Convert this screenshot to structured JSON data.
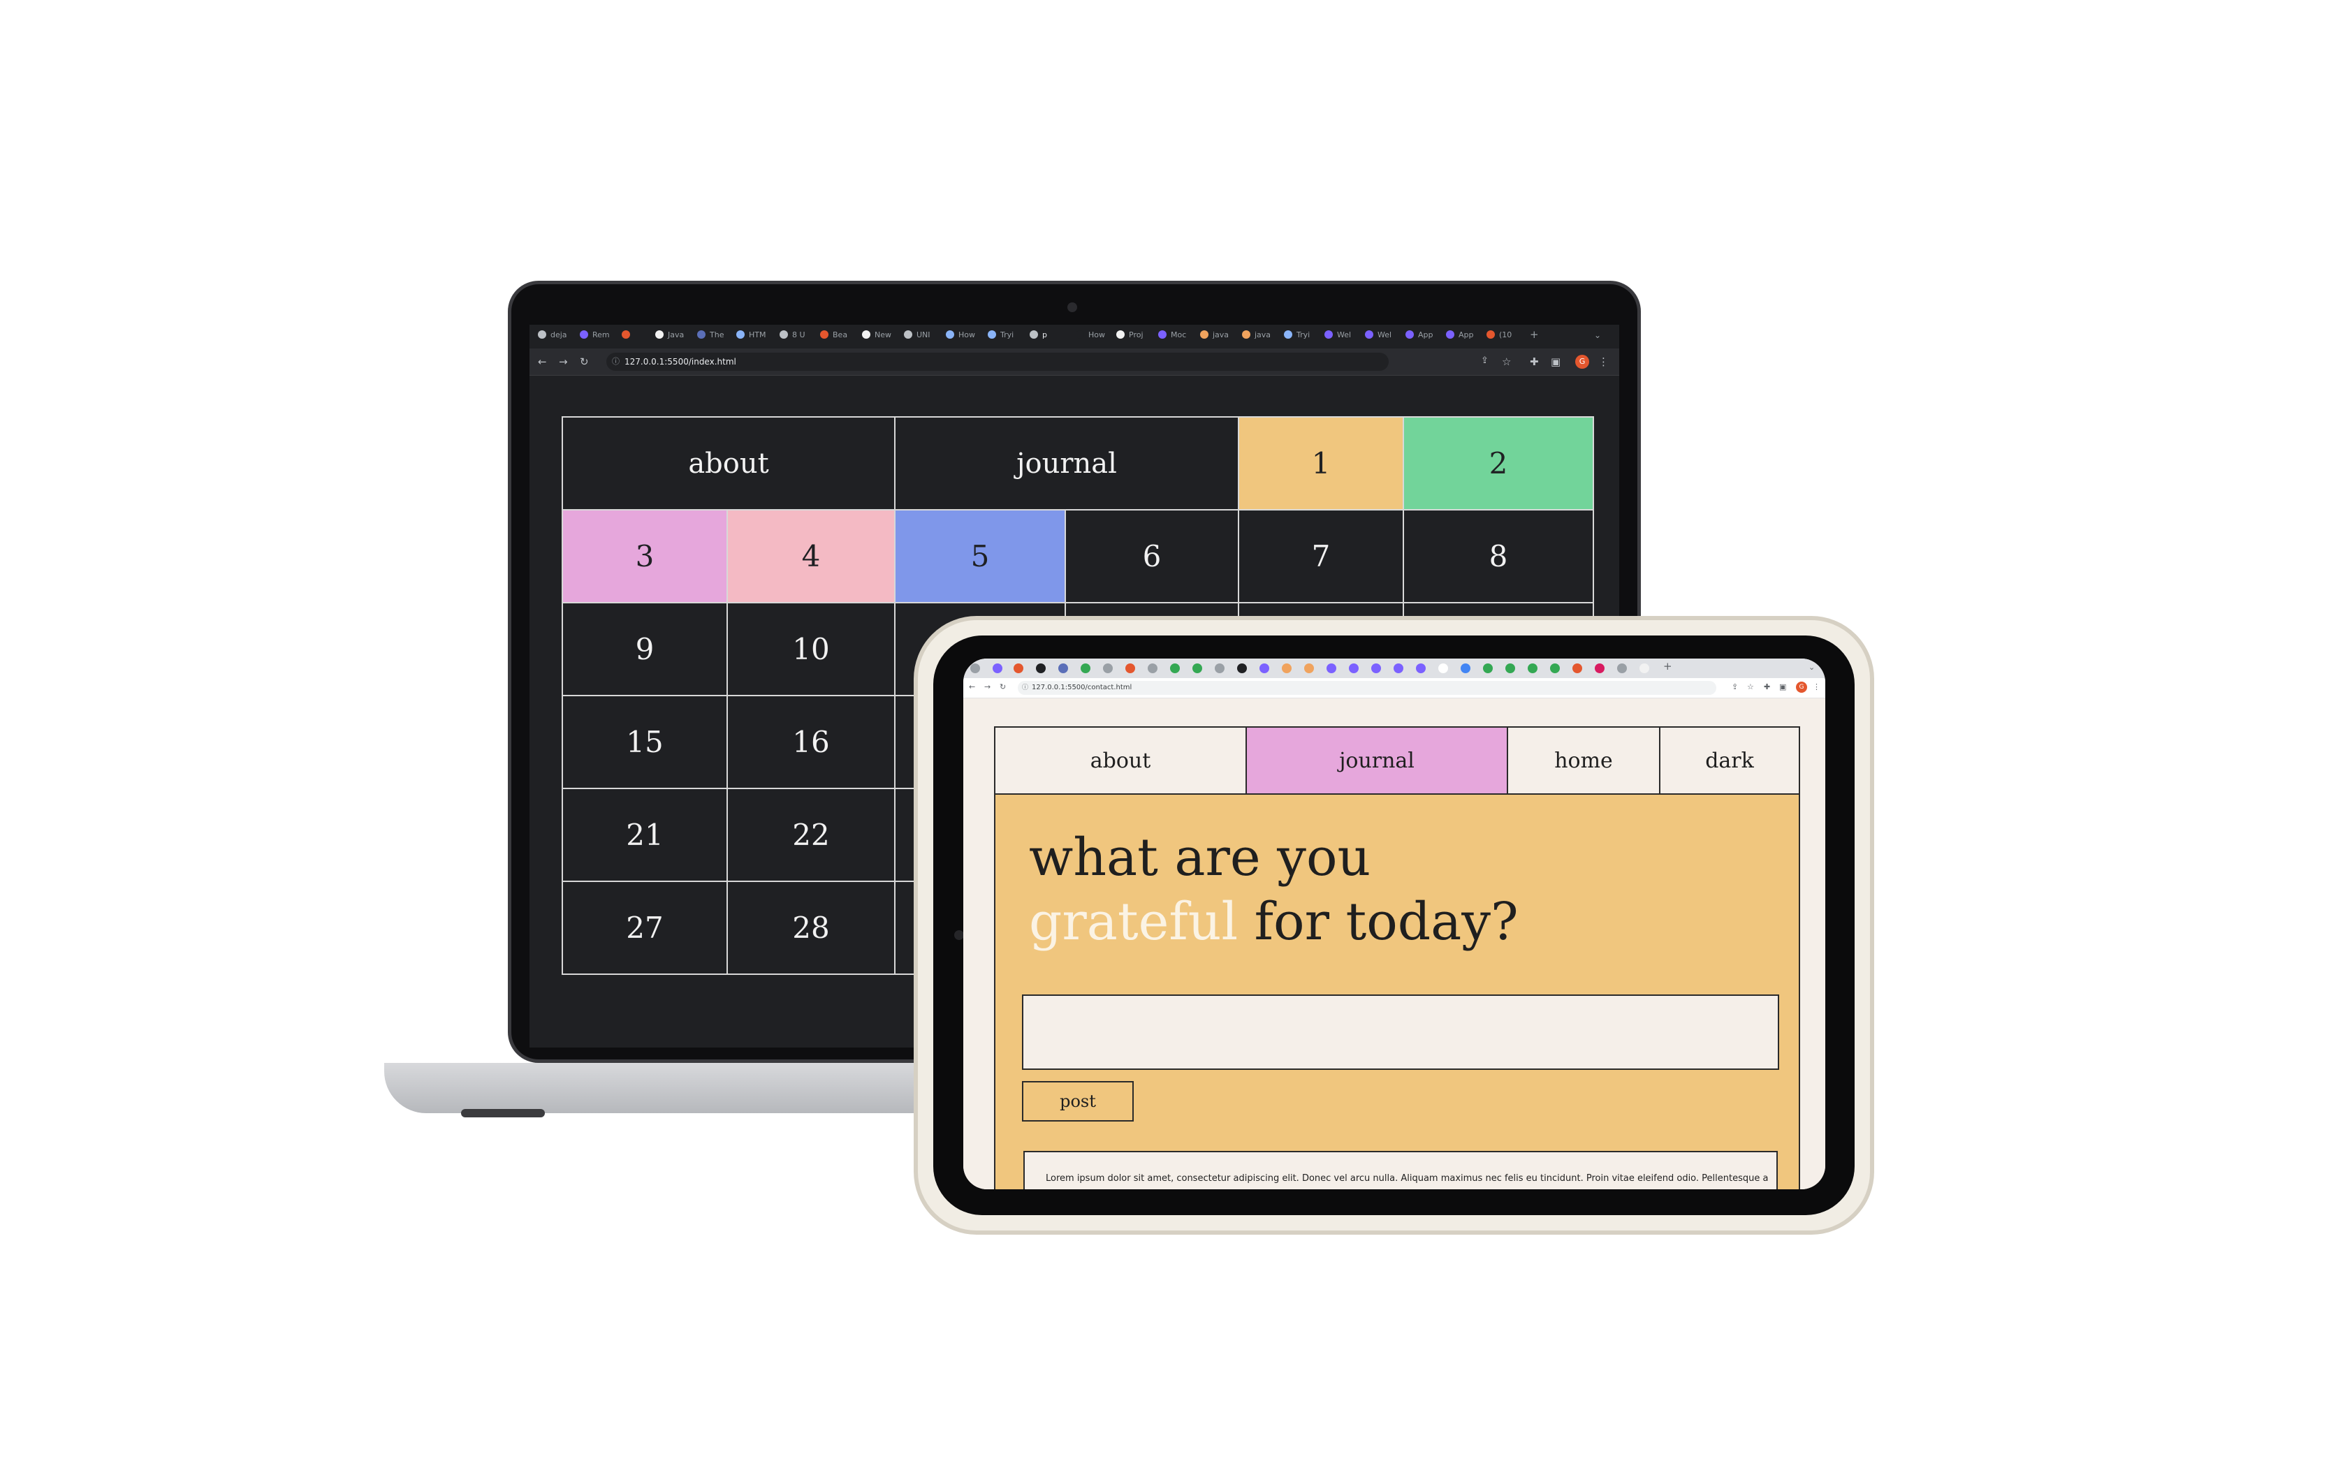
{
  "laptop": {
    "url": "127.0.0.1:5500/index.html",
    "tabs": [
      "deja",
      "Rem",
      "",
      "Java",
      "The",
      "HTM",
      "8 U",
      "Bea",
      "New",
      "UNI",
      "How",
      "Tryi",
      "p",
      "How",
      "Proj",
      "Moc",
      "java",
      "java",
      "Tryi",
      "Wel",
      "Wel",
      "App",
      "App",
      "(10"
    ],
    "avatar_letter": "G",
    "calendar": {
      "header": [
        "about",
        "journal",
        "1",
        "2"
      ],
      "rows": [
        [
          "3",
          "4",
          "5",
          "6",
          "7",
          "8"
        ],
        [
          "9",
          "10",
          "",
          "",
          "",
          ""
        ],
        [
          "15",
          "16",
          "",
          "",
          "",
          ""
        ],
        [
          "21",
          "22",
          "",
          "",
          "",
          ""
        ],
        [
          "27",
          "28",
          "",
          "",
          "",
          ""
        ]
      ]
    }
  },
  "tablet": {
    "url": "127.0.0.1:5500/contact.html",
    "avatar_letter": "G",
    "nav": {
      "about": "about",
      "journal": "journal",
      "home": "home",
      "dark": "dark"
    },
    "heading": {
      "line1": "what are you",
      "accent": "grateful",
      "rest": " for today?"
    },
    "entry_placeholder": "",
    "post_button": "post",
    "post_text": "Lorem ipsum dolor sit amet, consectetur adipiscing elit. Donec vel arcu nulla. Aliquam maximus nec felis eu tincidunt. Proin vitae eleifend odio. Pellentesque a"
  },
  "colors": {
    "mustard": "#f0c67e",
    "green": "#72d49a",
    "orchid": "#e6a7dc",
    "pink": "#f4bac4",
    "periwinkle": "#7f97ea",
    "dark_bg": "#1f2023",
    "cream": "#f5efe9"
  },
  "icons": [
    "back-icon",
    "forward-icon",
    "reload-icon",
    "info-icon",
    "share-icon",
    "star-icon",
    "extensions-icon",
    "sidebar-icon",
    "menu-icon"
  ]
}
